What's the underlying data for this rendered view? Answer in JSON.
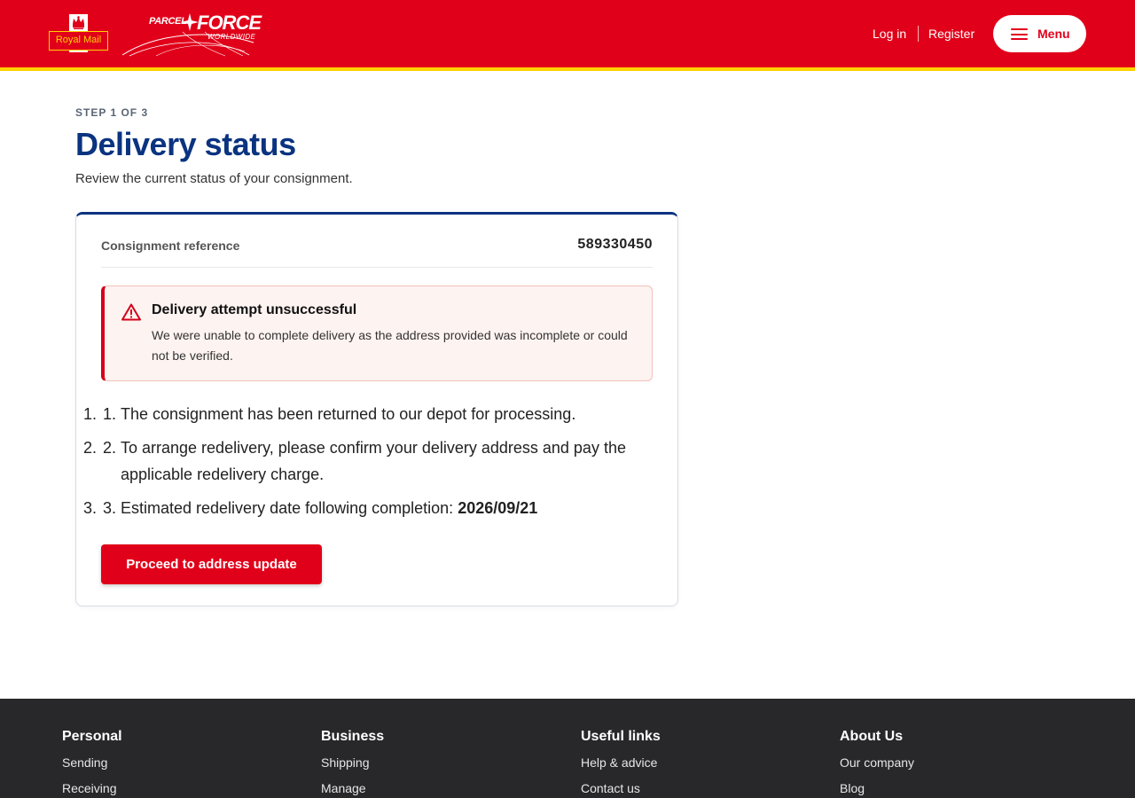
{
  "header": {
    "royal_mail_logo_text": "Royal Mail",
    "parcelforce_logo": {
      "parcel": "PARCEL",
      "force": "FORCE",
      "worldwide": "WORLDWIDE"
    },
    "login_label": "Log in",
    "register_label": "Register",
    "menu_label": "Menu",
    "brand_red": "#e1001a",
    "brand_yellow": "#ffd100"
  },
  "main": {
    "step_label": "STEP 1 OF 3",
    "title": "Delivery status",
    "subtitle": "Review the current status of your consignment."
  },
  "card": {
    "reference_label": "Consignment reference",
    "reference_value": "589330450",
    "alert": {
      "title": "Delivery attempt unsuccessful",
      "body": "We were unable to complete delivery as the address provided was incomplete or could not be verified."
    },
    "steps": [
      {
        "number": "1.",
        "text": "The consignment has been returned to our depot for processing."
      },
      {
        "number": "2.",
        "text": "To arrange redelivery, please confirm your delivery address and pay the applicable redelivery charge."
      },
      {
        "number": "3.",
        "text": "Estimated redelivery date following completion: ",
        "date": "2026/09/21"
      }
    ],
    "button_label": "Proceed to address update"
  },
  "footer": {
    "columns": [
      {
        "heading": "Personal",
        "links": [
          "Sending",
          "Receiving"
        ]
      },
      {
        "heading": "Business",
        "links": [
          "Shipping",
          "Manage"
        ]
      },
      {
        "heading": "Useful links",
        "links": [
          "Help & advice",
          "Contact us"
        ]
      },
      {
        "heading": "About Us",
        "links": [
          "Our company",
          "Blog"
        ]
      }
    ]
  }
}
